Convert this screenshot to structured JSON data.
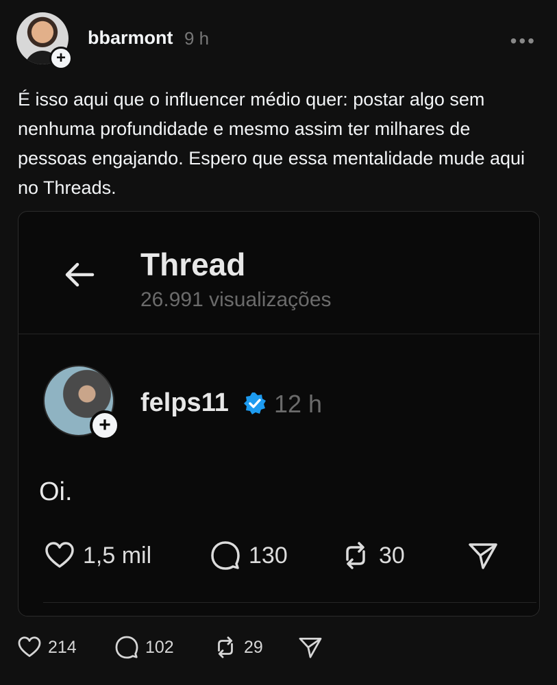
{
  "post": {
    "username": "bbarmont",
    "timestamp": "9 h",
    "more_label": "•••",
    "body": "É isso aqui que o influencer médio quer: postar algo sem nenhuma profundidade e mesmo assim ter milhares de pessoas engajando. Espero que essa mentalidade mude aqui no Threads.",
    "follow_badge": "+",
    "actions": {
      "likes": "214",
      "replies": "102",
      "reposts": "29"
    }
  },
  "embed": {
    "title": "Thread",
    "views": "26.991 visualizações",
    "inner_post": {
      "username": "felps11",
      "verified": true,
      "timestamp": "12 h",
      "text": "Oi.",
      "follow_badge": "+",
      "actions": {
        "likes": "1,5 mil",
        "replies": "130",
        "reposts": "30"
      }
    }
  },
  "icons": {
    "verified_color": "#1d9bf0",
    "avatar_icon": "avatar",
    "like_icon": "heart-icon",
    "reply_icon": "speech-bubble-icon",
    "repost_icon": "repost-icon",
    "share_icon": "send-icon"
  }
}
